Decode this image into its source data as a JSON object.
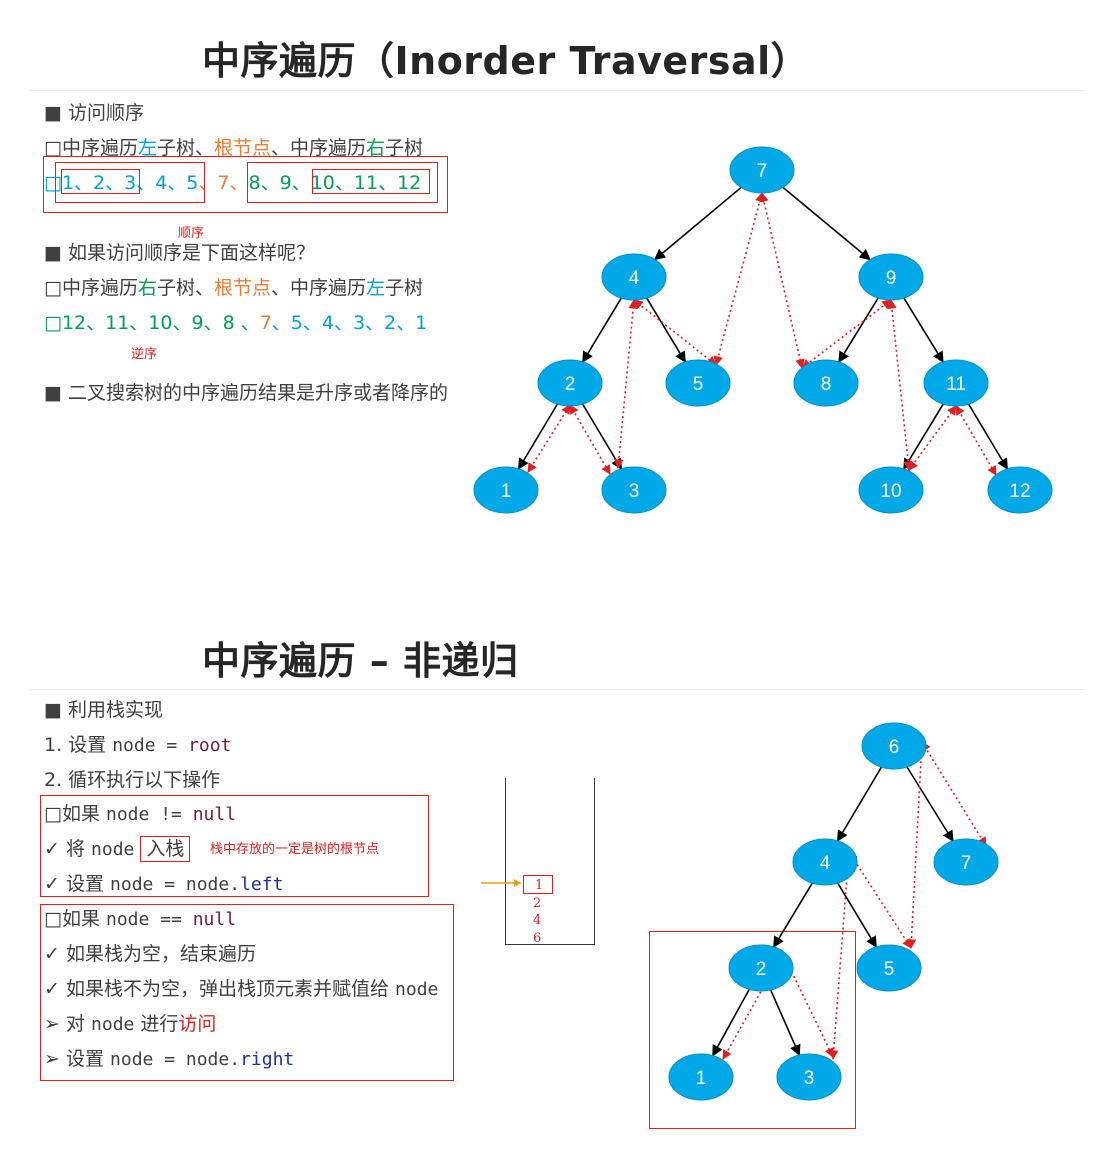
{
  "section1": {
    "title": "中序遍历（Inorder Traversal）",
    "bullet_visit": "■ 访问顺序",
    "order_rule": {
      "prefix": "中序遍历",
      "left1": "左",
      "mid1": "子树、",
      "root": "根节点",
      "mid2": "、中序遍历",
      "right1": "右",
      "suffix": "子树"
    },
    "sequence": {
      "p1": "1、2、3",
      "p2": "、4、5",
      "sep1": "、",
      "p3": "7",
      "sep2": "、",
      "p4": "8、9、",
      "p5": "10、11、12"
    },
    "note_order": "顺序",
    "bullet_what_if": "■ 如果访问顺序是下面这样呢？",
    "reverse_rule": {
      "prefix": "中序遍历",
      "right1": "右",
      "mid1": "子树、",
      "root": "根节点",
      "mid2": "、中序遍历",
      "left1": "左",
      "suffix": "子树"
    },
    "reverse_sequence": {
      "p1": "12、11、10、9、8 、",
      "p2": "7",
      "p3": "、5、4、3、2、1"
    },
    "note_reverse": "逆序",
    "bullet_bst": "■ 二叉搜索树的中序遍历结果是升序或者降序的",
    "tree_nodes": [
      "7",
      "4",
      "9",
      "2",
      "5",
      "8",
      "11",
      "1",
      "3",
      "10",
      "12"
    ]
  },
  "section2": {
    "title": "中序遍历 – 非递归",
    "bullet_stack": "■ 利用栈实现",
    "step1_prefix": "1.  设置 ",
    "step1_code_a": "node",
    "step1_code_eq": " = ",
    "step1_code_b": "root",
    "step2": "2.  循环执行以下操作",
    "if_not_null_prefix": "如果 ",
    "if_not_null_code": "node",
    "if_not_null_op": " != ",
    "if_not_null_val": "null",
    "push_prefix": "将 ",
    "push_code": "node",
    "push_action": "入栈",
    "push_note": "栈中存放的一定是树的根节点",
    "set_left_prefix": "设置 ",
    "set_left_code": "node = node.",
    "set_left_field": "left",
    "if_null_prefix": "如果 ",
    "if_null_code": "node",
    "if_null_op": " == ",
    "if_null_val": "null",
    "empty_stack": "如果栈为空，结束遍历",
    "pop_stack_prefix": "如果栈不为空，弹出栈顶元素并赋值给 ",
    "pop_stack_code": "node",
    "visit_prefix": "对 ",
    "visit_code": "node",
    "visit_mid": " 进行",
    "visit_word": "访问",
    "set_right_prefix": "设置 ",
    "set_right_code": "node = node.",
    "set_right_field": "right",
    "stack_items": [
      "1",
      "2",
      "4",
      "6"
    ],
    "tree_nodes": [
      "6",
      "4",
      "7",
      "2",
      "5",
      "1",
      "3"
    ]
  },
  "colors": {
    "node_fill": "#00a8e8",
    "node_stroke": "#0090c8",
    "edge": "#000000",
    "dotted": "#e02020",
    "accent_blue": "#00a0e0",
    "accent_orange": "#ed7d31",
    "accent_green": "#00a050"
  },
  "icons": {
    "square_bullet": "hollow-square-icon",
    "check_bullet": "check-icon",
    "arrow_bullet": "arrow-right-icon"
  }
}
